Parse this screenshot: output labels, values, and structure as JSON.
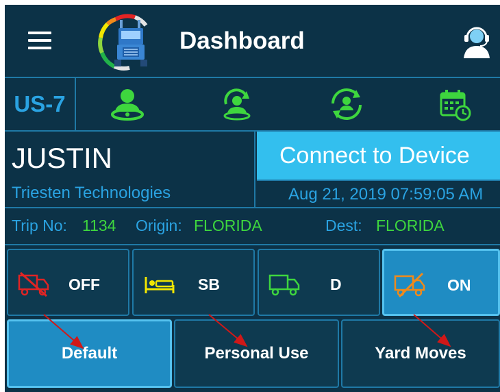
{
  "header": {
    "title": "Dashboard",
    "menu_icon": "hamburger-menu-icon",
    "logo_icon": "truck-gauge-logo",
    "support_icon": "support-agent-icon"
  },
  "status_bar": {
    "unit": "US-7",
    "icons": [
      "driver-icon",
      "driver-sync-icon",
      "co-driver-switch-icon",
      "calendar-clock-icon"
    ]
  },
  "driver": {
    "name": "JUSTIN",
    "company": "Triesten Technologies"
  },
  "connect": {
    "label": "Connect to Device",
    "datetime": "Aug 21, 2019 07:59:05 AM"
  },
  "trip": {
    "trip_label": "Trip No:",
    "trip_value": "1134",
    "origin_label": "Origin:",
    "origin_value": "FLORIDA",
    "dest_label": "Dest:",
    "dest_value": "FLORIDA"
  },
  "duty_status": [
    {
      "label": "OFF",
      "icon": "truck-off-icon",
      "color": "#e02424",
      "active": false
    },
    {
      "label": "SB",
      "icon": "bed-icon",
      "color": "#f2e600",
      "active": false
    },
    {
      "label": "D",
      "icon": "truck-driving-icon",
      "color": "#3ed63e",
      "active": false
    },
    {
      "label": "ON",
      "icon": "truck-on-duty-icon",
      "color": "#f08a1a",
      "active": true
    }
  ],
  "modes": [
    {
      "label": "Default",
      "active": true
    },
    {
      "label": "Personal Use",
      "active": false
    },
    {
      "label": "Yard Moves",
      "active": false
    }
  ],
  "colors": {
    "background": "#0c3247",
    "border": "#1f79a6",
    "accent_blue": "#2aa3e2",
    "connect_bg": "#33bfee",
    "value_green": "#3ed63e",
    "annotation_arrow": "#d01818"
  }
}
